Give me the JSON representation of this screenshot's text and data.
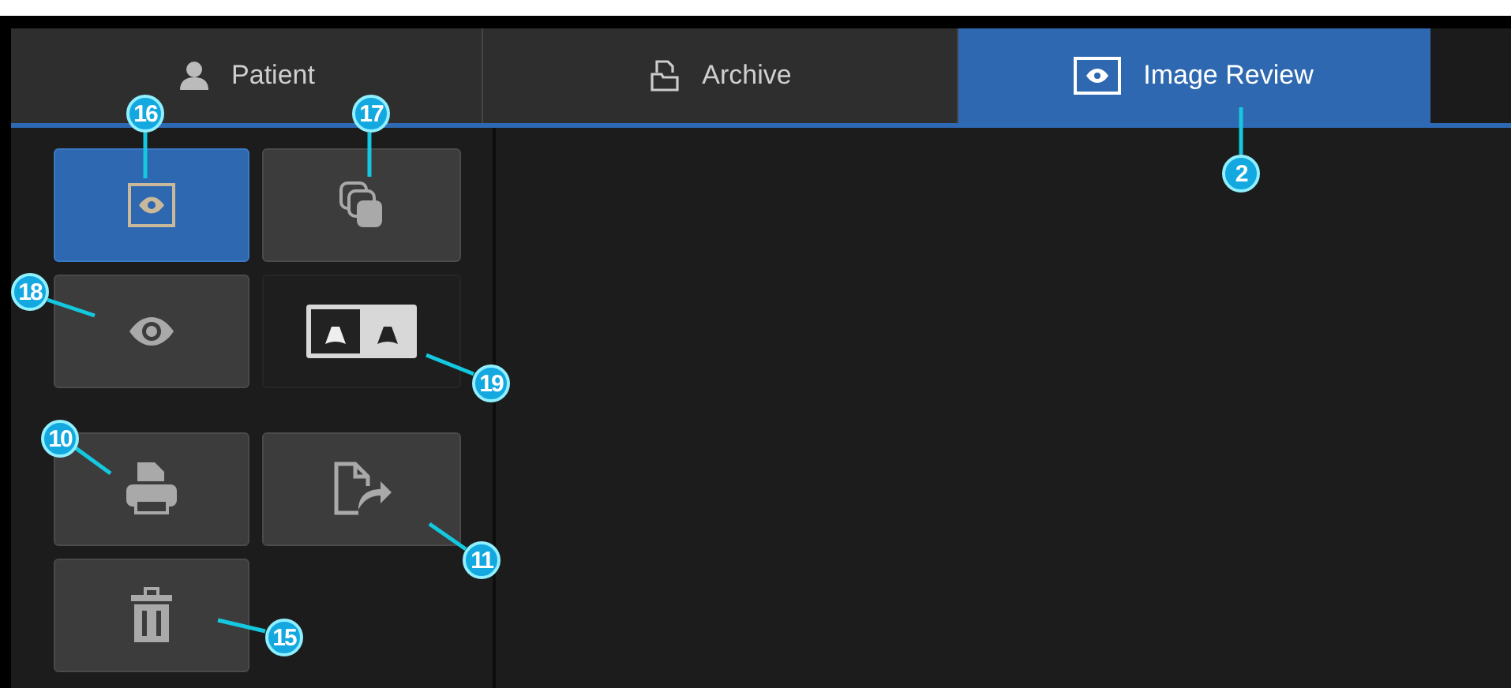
{
  "tabs": [
    {
      "label": "Patient",
      "selected": false
    },
    {
      "label": "Archive",
      "selected": false
    },
    {
      "label": "Image Review",
      "selected": true
    }
  ],
  "button_groups": [
    {
      "buttons": [
        {
          "selected": true
        },
        {
          "selected": false
        },
        {
          "selected": false
        },
        {
          "selected": false
        }
      ]
    },
    {
      "buttons": [
        {
          "selected": false
        },
        {
          "selected": false
        },
        {
          "selected": false
        }
      ]
    }
  ],
  "callouts": [
    {
      "label": "2"
    },
    {
      "label": "16"
    },
    {
      "label": "17"
    },
    {
      "label": "18"
    },
    {
      "label": "19"
    },
    {
      "label": "10"
    },
    {
      "label": "11"
    },
    {
      "label": "15"
    }
  ]
}
